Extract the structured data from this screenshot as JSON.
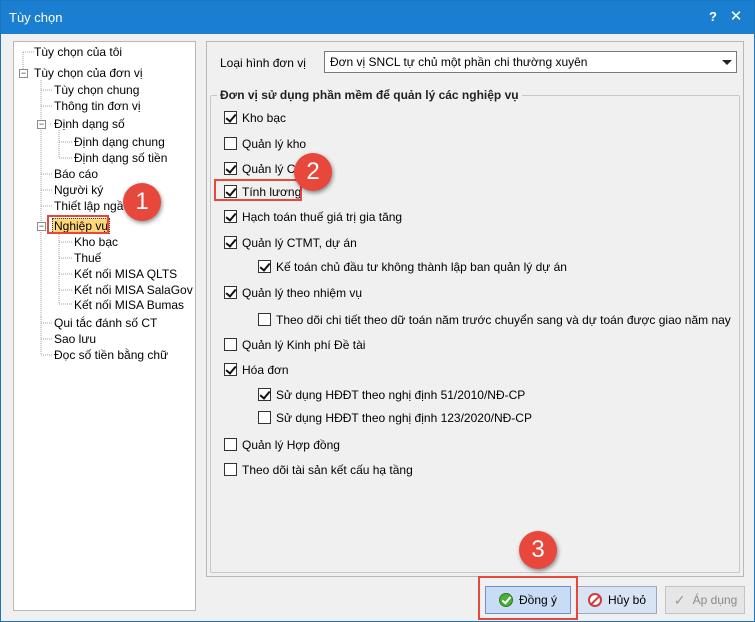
{
  "window": {
    "title": "Tùy chọn",
    "help_label": "?",
    "close_label": "✕"
  },
  "tree": {
    "items": [
      {
        "label": "Tùy chọn của tôi"
      },
      {
        "label": "Tùy chọn của đơn vị",
        "expander": "−"
      },
      {
        "label": "Tùy chọn chung"
      },
      {
        "label": "Thông tin đơn vị"
      },
      {
        "label": "Định dạng số",
        "expander": "−"
      },
      {
        "label": "Định dạng chung"
      },
      {
        "label": "Định dạng số tiền"
      },
      {
        "label": "Báo cáo"
      },
      {
        "label": "Người ký"
      },
      {
        "label": "Thiết lập ngầ"
      },
      {
        "label": "Nghiệp vụ",
        "expander": "−"
      },
      {
        "label": "Kho bạc"
      },
      {
        "label": "Thuế"
      },
      {
        "label": "Kết nối MISA QLTS"
      },
      {
        "label": "Kết nối MISA SalaGov"
      },
      {
        "label": "Kết nối MISA Bumas"
      },
      {
        "label": "Qui tắc đánh số CT"
      },
      {
        "label": "Sao lưu"
      },
      {
        "label": "Đọc số tiền bằng chữ"
      }
    ]
  },
  "main": {
    "unit_type_label": "Loại hình đơn vị",
    "unit_type_value": "Đơn vị SNCL tự chủ một phần chi thường xuyên",
    "group_title": "Đơn vị sử dụng phần mềm để quản lý các nghiệp vụ",
    "options": [
      {
        "label": "Kho bạc",
        "checked": true
      },
      {
        "label": "Quản lý kho",
        "checked": false
      },
      {
        "label": "Quản lý CC",
        "checked": true
      },
      {
        "label": "Tính lương",
        "checked": true
      },
      {
        "label": "Hạch toán thuế giá trị gia tăng",
        "checked": true
      },
      {
        "label": "Quản lý CTMT, dự án",
        "checked": true
      },
      {
        "label": "Kế toán chủ đầu tư không thành lập ban quản lý dự án",
        "checked": true
      },
      {
        "label": "Quản lý theo nhiệm vụ",
        "checked": true
      },
      {
        "label": "Theo dõi chi tiết theo dữ toán năm trước chuyển sang và dự toán được giao năm nay",
        "checked": false
      },
      {
        "label": "Quản lý Kinh phí Đề tài",
        "checked": false
      },
      {
        "label": "Hóa đơn",
        "checked": true
      },
      {
        "label": "Sử dụng HĐĐT theo nghị định 51/2010/NĐ-CP",
        "checked": true
      },
      {
        "label": "Sử dụng HĐĐT theo nghị định 123/2020/NĐ-CP",
        "checked": false
      },
      {
        "label": "Quản lý Hợp đồng",
        "checked": false
      },
      {
        "label": "Theo dõi tài sản kết cấu hạ tầng",
        "checked": false
      }
    ]
  },
  "buttons": {
    "ok": "Đồng ý",
    "cancel": "Hủy bỏ",
    "apply": "Áp dụng"
  },
  "annotations": {
    "step1": "1",
    "step2": "2",
    "step3": "3"
  },
  "colors": {
    "titlebar": "#1b7fd1",
    "accent_red": "#e8473b"
  }
}
